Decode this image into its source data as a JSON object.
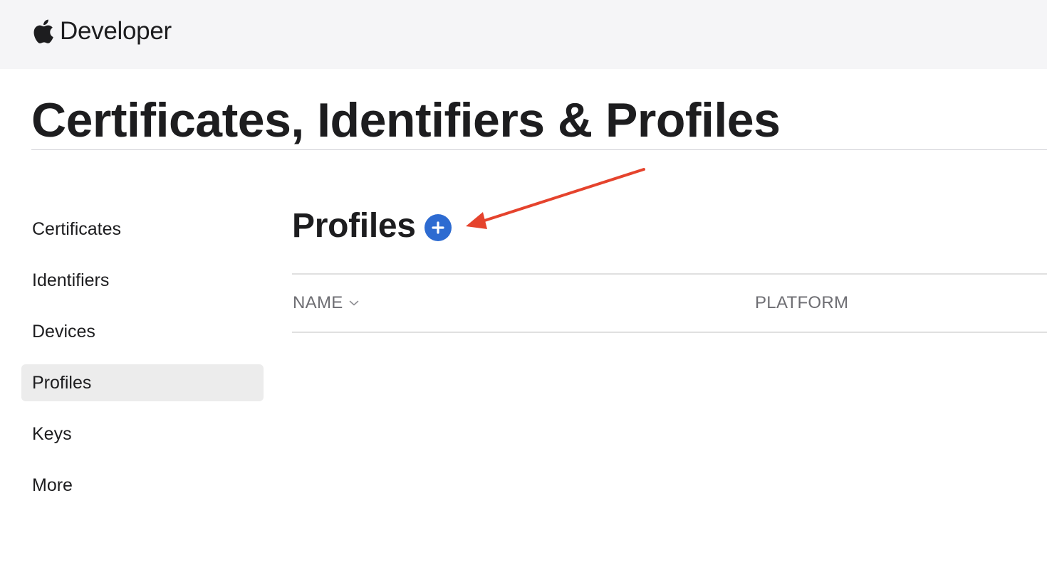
{
  "header": {
    "brand_text": "Developer",
    "logo_icon": "apple-logo-icon"
  },
  "page": {
    "title": "Certificates, Identifiers & Profiles"
  },
  "sidebar": {
    "items": [
      {
        "label": "Certificates",
        "active": false
      },
      {
        "label": "Identifiers",
        "active": false
      },
      {
        "label": "Devices",
        "active": false
      },
      {
        "label": "Profiles",
        "active": true
      },
      {
        "label": "Keys",
        "active": false
      },
      {
        "label": "More",
        "active": false
      }
    ]
  },
  "main": {
    "section_title": "Profiles",
    "add_icon": "plus-circle-icon",
    "table": {
      "columns": [
        {
          "label": "NAME",
          "sortable": true,
          "sort_icon": "chevron-down-icon"
        },
        {
          "label": "PLATFORM",
          "sortable": false
        }
      ],
      "rows": []
    }
  },
  "annotation": {
    "arrow_icon": "red-arrow-icon",
    "color": "#e5432d"
  },
  "colors": {
    "accent": "#2d6bd1",
    "header_bg": "#f5f5f7",
    "active_bg": "#ececec"
  }
}
